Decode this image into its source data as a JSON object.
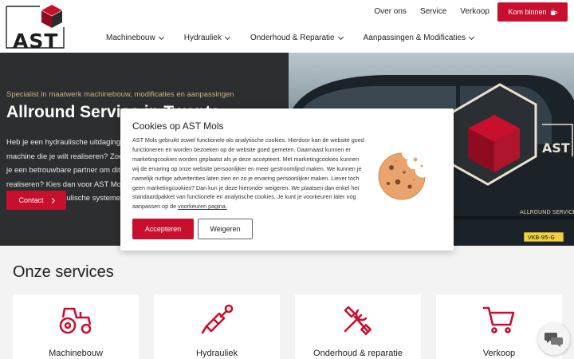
{
  "brand": {
    "logo_text": "AST",
    "accent": "#c8102e"
  },
  "header": {
    "top_links": [
      "Over ons",
      "Service",
      "Verkoop"
    ],
    "cta_label": "Kom binnen",
    "nav": [
      "Machinebouw",
      "Hydrauliek",
      "Onderhoud & Reparatie",
      "Aanpassingen & Modificaties"
    ]
  },
  "hero": {
    "subtitle": "Specialist in maatwerk machinebouw, modificaties en aanpassingen",
    "title": "Allround Service in Twente",
    "text": "Heb je een hydraulische uitdaging of machine die je wilt realiseren? Zoek je een betrouwbare partner om dit te realiseren? Kies dan voor AST Mols, specialist in hydraulische systemen!",
    "contact_label": "Contact",
    "van_text": "ALLROUND SERVICE",
    "van_plate": "VKB-95-G"
  },
  "cookie": {
    "title": "Cookies op AST Mols",
    "body": "AST Mols gebruikt zowel functionele als analytische cookies. Hierdoor kan de website goed functioneren en worden bezoeken op de website goed gemeten. Daarnaast kunnen er marketingcookies worden geplaatst als je deze accepteert. Met marketingcookies kunnen wij de ervaring op onze website persoonlijker en meer gestroomlijnd maken. We kunnen je namelijk nuttige advertenties laten zien en zo je ervaring persoonlijker maken. Liever toch geen marketingcookies? Dan kun je deze hieronder weigeren. We plaatsen dan enkel het standaardpakket van functionele en analytische cookies. Je kunt je voorkeuren later nog aanpassen op de ",
    "link": "voorkeuren pagina.",
    "accept": "Accepteren",
    "refuse": "Weigeren"
  },
  "services": {
    "title": "Onze services",
    "cards": [
      {
        "label": "Machinebouw",
        "icon": "tractor-icon"
      },
      {
        "label": "Hydrauliek",
        "icon": "hydraulic-cylinder-icon"
      },
      {
        "label": "Onderhoud & reparatie",
        "icon": "tools-icon"
      },
      {
        "label": "Verkoop",
        "icon": "cart-icon"
      }
    ]
  }
}
